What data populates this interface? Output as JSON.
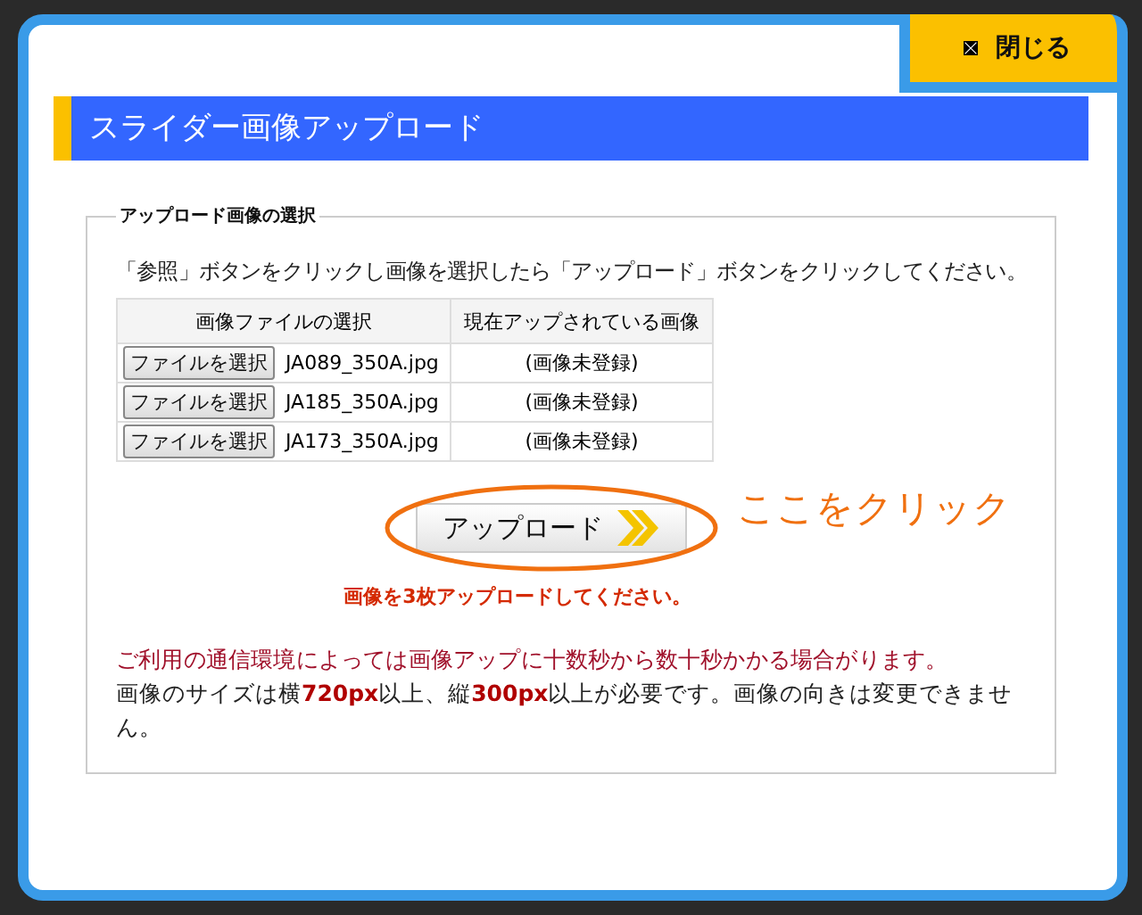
{
  "close_button": {
    "label": "閉じる"
  },
  "title": "スライダー画像アップロード",
  "section": {
    "legend": "アップロード画像の選択",
    "instruction": "「参照」ボタンをクリックし画像を選択したら「アップロード」ボタンをクリックしてください。",
    "table": {
      "columns": [
        "画像ファイルの選択",
        "現在アップされている画像"
      ],
      "rows": [
        {
          "button": "ファイルを選択",
          "file": "JA089_350A.jpg",
          "current": "(画像未登録)"
        },
        {
          "button": "ファイルを選択",
          "file": "JA185_350A.jpg",
          "current": "(画像未登録)"
        },
        {
          "button": "ファイルを選択",
          "file": "JA173_350A.jpg",
          "current": "(画像未登録)"
        }
      ]
    },
    "upload_button": "アップロード",
    "annotation": "ここをクリック",
    "warning": "画像を3枚アップロードしてください。",
    "notes": [
      {
        "kind": "alert",
        "text": "ご利用の通信環境によっては画像アップに十数秒から数十秒かかる場合がります。"
      },
      {
        "kind": "plain",
        "text": "画像のサイズは横**720px**以上、縦**300px**以上が必要です。画像の向きは変更できません。"
      }
    ]
  }
}
